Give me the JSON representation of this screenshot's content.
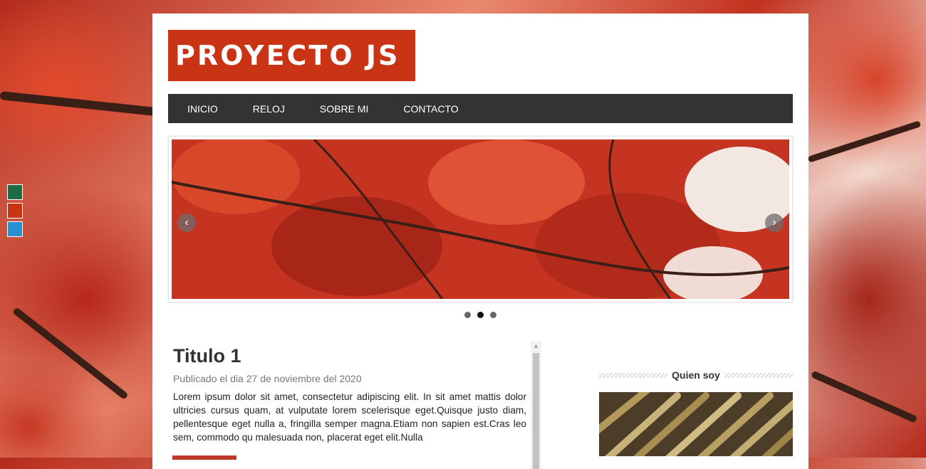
{
  "logo": {
    "text": "PROYECTO JS"
  },
  "menu": {
    "items": [
      "INICIO",
      "RELOJ",
      "SOBRE MI",
      "CONTACTO"
    ]
  },
  "theme_switcher": {
    "colors": [
      "#1f6b43",
      "#c93414",
      "#2a8fd1"
    ]
  },
  "slider": {
    "prev_icon": "chevron-left-icon",
    "next_icon": "chevron-right-icon",
    "slide_count": 3,
    "active_slide": 2
  },
  "article": {
    "title": "Titulo 1",
    "meta": "Publicado el dia 27 de noviembre del 2020",
    "body": "Lorem ipsum dolor sit amet, consectetur adipiscing elit. In sit amet mattis dolor ultricies cursus quam, at vulputate lorem scelerisque eget.Quisque justo diam, pellentesque eget nulla a, fringilla semper magna.Etiam non sapien est.Cras leo sem, commodo qu malesuada non, placerat eget elit.Nulla"
  },
  "sidebar": {
    "widget_title": "Quien soy"
  },
  "colors": {
    "accent": "#c93414",
    "menu_bg": "#333333"
  }
}
